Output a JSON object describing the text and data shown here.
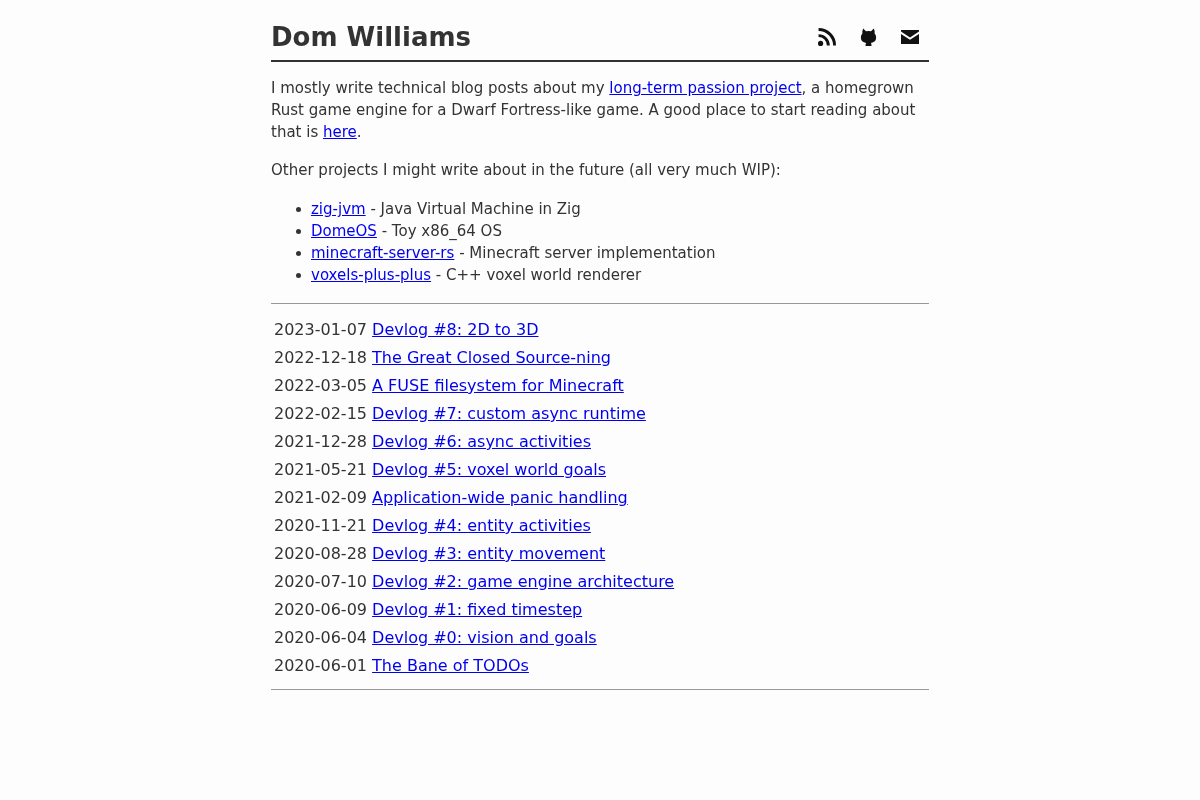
{
  "header": {
    "title": "Dom Williams"
  },
  "intro": [
    {
      "kind": "text",
      "text": "I mostly write technical blog posts about my "
    },
    {
      "kind": "link",
      "text": "long-term passion project"
    },
    {
      "kind": "text",
      "text": ", a homegrown Rust game engine for a Dwarf Fortress-like game. A good place to start reading about that is "
    },
    {
      "kind": "link",
      "text": "here"
    },
    {
      "kind": "text",
      "text": "."
    }
  ],
  "projects_intro": "Other projects I might write about in the future (all very much WIP):",
  "projects": [
    {
      "name": "zig-jvm",
      "description": "- Java Virtual Machine in Zig"
    },
    {
      "name": "DomeOS",
      "description": "- Toy x86_64 OS"
    },
    {
      "name": "minecraft-server-rs",
      "description": "- Minecraft server implementation"
    },
    {
      "name": "voxels-plus-plus",
      "description": "- C++ voxel world renderer"
    }
  ],
  "posts": [
    {
      "date": "2023-01-07",
      "title": "Devlog #8: 2D to 3D"
    },
    {
      "date": "2022-12-18",
      "title": "The Great Closed Source-ning"
    },
    {
      "date": "2022-03-05",
      "title": "A FUSE filesystem for Minecraft"
    },
    {
      "date": "2022-02-15",
      "title": "Devlog #7: custom async runtime"
    },
    {
      "date": "2021-12-28",
      "title": "Devlog #6: async activities"
    },
    {
      "date": "2021-05-21",
      "title": "Devlog #5: voxel world goals"
    },
    {
      "date": "2021-02-09",
      "title": "Application-wide panic handling"
    },
    {
      "date": "2020-11-21",
      "title": "Devlog #4: entity activities"
    },
    {
      "date": "2020-08-28",
      "title": "Devlog #3: entity movement"
    },
    {
      "date": "2020-07-10",
      "title": "Devlog #2: game engine architecture"
    },
    {
      "date": "2020-06-09",
      "title": "Devlog #1: fixed timestep"
    },
    {
      "date": "2020-06-04",
      "title": "Devlog #0: vision and goals"
    },
    {
      "date": "2020-06-01",
      "title": "The Bane of TODOs"
    }
  ]
}
